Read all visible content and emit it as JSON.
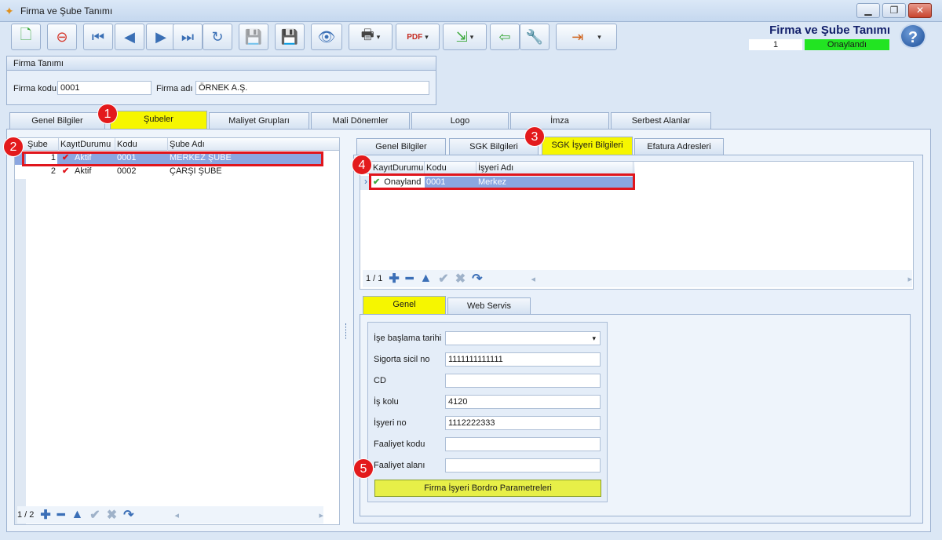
{
  "window": {
    "title": "Firma ve Şube Tanımı",
    "min": "▁",
    "restore": "❐",
    "close": "✕"
  },
  "header": {
    "title": "Firma ve Şube Tanımı",
    "record_no": "1",
    "status": "Onaylandı",
    "help": "?"
  },
  "toolbar": {
    "icons": [
      "new-doc-icon",
      "delete-doc-icon",
      "first-icon",
      "prev-icon",
      "next-icon",
      "last-icon",
      "refresh-icon",
      "save-disabled-icon",
      "save-cancel-icon",
      "preview-icon",
      "print-icon",
      "pdf-save-icon",
      "export-icon",
      "import-icon",
      "settings-icon",
      "exit-icon"
    ],
    "glyphs": {
      "new": "🗋",
      "delete": "⊖",
      "first": "⏮",
      "prev": "◀",
      "next": "▶",
      "last": "⏭",
      "refresh": "↻",
      "save": "💾",
      "savex": "💾",
      "preview": "👁",
      "print": "🖶",
      "pdf": "PDF",
      "export": "⇲",
      "import": "⇦",
      "tools": "🔧",
      "exit": "⇥",
      "dd": "▾"
    }
  },
  "firma": {
    "group_title": "Firma Tanımı",
    "kod_label": "Firma kodu",
    "kod_value": "0001",
    "ad_label": "Firma adı",
    "ad_value": "ÖRNEK A.Ş."
  },
  "main_tabs": [
    "Genel Bilgiler",
    "Şubeler",
    "Maliyet Grupları",
    "Mali Dönemler",
    "Logo",
    "İmza",
    "Serbest Alanlar"
  ],
  "subeler": {
    "columns": [
      "Şube No",
      "KayıtDurumu",
      "Kodu",
      "Şube Adı"
    ],
    "rows": [
      {
        "no": "1",
        "durum": "Aktif",
        "kodu": "0001",
        "ad": "MERKEZ ŞUBE"
      },
      {
        "no": "2",
        "durum": "Aktif",
        "kodu": "0002",
        "ad": "ÇARŞI ŞUBE"
      }
    ],
    "pager": "1 / 2"
  },
  "sub_tabs": [
    "Genel Bilgiler",
    "SGK Bilgileri",
    "SGK İşyeri Bilgileri",
    "Efatura Adresleri"
  ],
  "sgk": {
    "columns": [
      "KayıtDurumu",
      "Kodu",
      "İşyeri Adı"
    ],
    "rows": [
      {
        "durum": "Onayland",
        "kodu": "0001",
        "ad": "Merkez"
      }
    ],
    "pager": "1 / 1"
  },
  "detail_tabs": [
    "Genel",
    "Web Servis"
  ],
  "form": {
    "fields": [
      {
        "label": "İşe başlama tarihi",
        "value": ""
      },
      {
        "label": "Sigorta sicil no",
        "value": "1111111111111"
      },
      {
        "label": "CD",
        "value": ""
      },
      {
        "label": "İş kolu",
        "value": "4120"
      },
      {
        "label": "İşyeri no",
        "value": "1112222333"
      },
      {
        "label": "Faaliyet kodu",
        "value": ""
      },
      {
        "label": "Faaliyet alanı",
        "value": ""
      }
    ],
    "button": "Firma İşyeri Bordro Parametreleri"
  },
  "badges": [
    "1",
    "2",
    "3",
    "4",
    "5"
  ],
  "nav_glyphs": {
    "add": "✚",
    "remove": "━",
    "up": "▲",
    "ok": "✔",
    "cancel": "✖",
    "redo": "↷",
    "left": "◂",
    "right": "▸",
    "row": "›",
    "check": "✔",
    "dd": "▾"
  },
  "colors": {
    "active_tab": "#f6f600",
    "status": "#22e422",
    "highlight": "#e0151c"
  }
}
